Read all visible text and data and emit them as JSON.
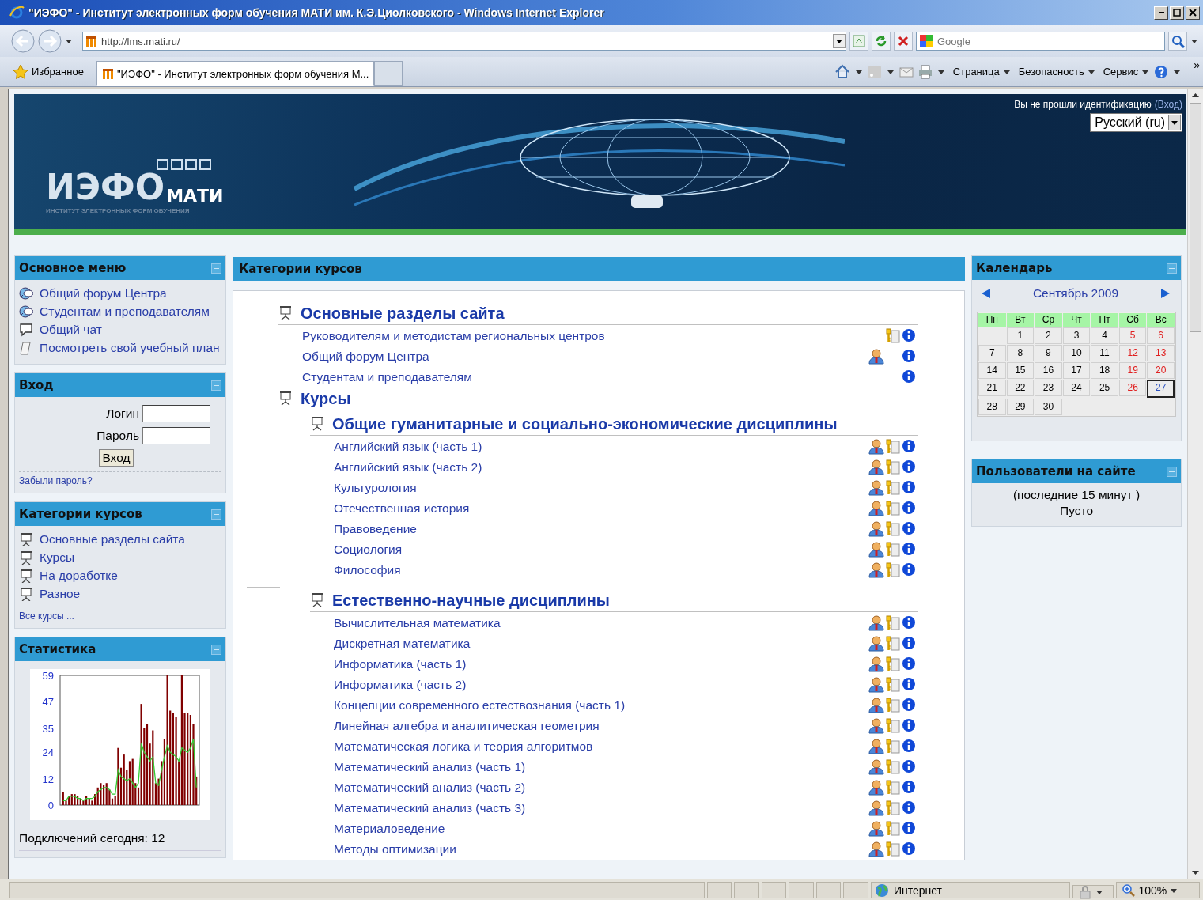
{
  "window": {
    "title": "\"ИЭФО\" - Институт электронных форм обучения МАТИ им. К.Э.Циолковского - Windows Internet Explorer"
  },
  "address_bar": {
    "value": "http://lms.mati.ru/"
  },
  "search": {
    "placeholder": "Google"
  },
  "favorites": {
    "label": "Избранное"
  },
  "tabs": [
    {
      "label": "\"ИЭФО\" - Институт электронных форм обучения М...",
      "selected": true
    }
  ],
  "command_bar": {
    "menus": [
      "Страница",
      "Безопасность",
      "Сервис"
    ],
    "overflow": "»"
  },
  "header": {
    "logo_main": "ИЭФО",
    "logo_sub": "МАТИ",
    "logo_tagline": "ИНСТИТУТ ЭЛЕКТРОННЫХ ФОРМ ОБУЧЕНИЯ",
    "login_info": "Вы не прошли идентификацию",
    "login_link": "(Вход)",
    "language": "Русский (ru)"
  },
  "main_menu": {
    "title": "Основное меню",
    "items": [
      {
        "label": "Общий форум Центра",
        "kind": "forum"
      },
      {
        "label": "Студентам и преподавателям",
        "kind": "forum"
      },
      {
        "label": "Общий чат",
        "kind": "chat"
      },
      {
        "label": "Посмотреть свой учебный план",
        "kind": "resource"
      }
    ]
  },
  "login": {
    "title": "Вход",
    "username_label": "Логин",
    "password_label": "Пароль",
    "submit": "Вход",
    "forgot_link": "Забыли пароль?"
  },
  "categories_block": {
    "title": "Категории курсов",
    "items": [
      "Основные разделы сайта",
      "Курсы",
      "На доработке",
      "Разное"
    ],
    "all_link": "Все курсы ..."
  },
  "statistics": {
    "title": "Статистика",
    "connections": "Подключений сегодня: 12",
    "chart_data": {
      "type": "bar",
      "categories": [
        null,
        null,
        null,
        null,
        null,
        null,
        null,
        null,
        null,
        null,
        null,
        null,
        null,
        null,
        null,
        null,
        null,
        null,
        null,
        null,
        null,
        null,
        null,
        null,
        null,
        null,
        null,
        null,
        null,
        null,
        null,
        null,
        null,
        null,
        null,
        null,
        null,
        null,
        null,
        null,
        null,
        null,
        null,
        null,
        null,
        null,
        null
      ],
      "ylim": [
        0,
        59
      ],
      "yticks": [
        0,
        12,
        24,
        35,
        47,
        59
      ],
      "series": [
        {
          "type": "bar",
          "color": "#800000",
          "values": [
            6,
            2,
            4,
            5,
            5,
            4,
            3,
            2,
            4,
            3,
            2,
            5,
            8,
            10,
            9,
            10,
            7,
            3,
            4,
            26,
            17,
            23,
            16,
            20,
            21,
            10,
            8,
            46,
            35,
            37,
            28,
            34,
            10,
            12,
            20,
            30,
            59,
            43,
            42,
            40,
            20,
            59,
            42,
            42,
            41,
            37,
            13
          ]
        },
        {
          "type": "line",
          "color": "#33cc33",
          "values": [
            2,
            2,
            4,
            4,
            4,
            3,
            3,
            2,
            3,
            3,
            3,
            4,
            6,
            7,
            8,
            8,
            7,
            5,
            5,
            16,
            13,
            12,
            11,
            12,
            10,
            8,
            10,
            28,
            24,
            22,
            20,
            22,
            10,
            9,
            16,
            22,
            27,
            24,
            23,
            22,
            20,
            26,
            25,
            24,
            26,
            30,
            8
          ]
        }
      ]
    }
  },
  "course_categories": {
    "title": "Категории курсов",
    "categories": [
      {
        "name": "Основные разделы сайта",
        "courses": [
          {
            "name": "Руководителям и методистам региональных центров",
            "guest_access": false,
            "enrolment_key": true,
            "summary": true
          },
          {
            "name": "Общий форум Центра",
            "guest_access": true,
            "enrolment_key": false,
            "summary": true
          },
          {
            "name": "Студентам и преподавателям",
            "guest_access": false,
            "enrolment_key": false,
            "summary": true
          }
        ]
      },
      {
        "name": "Курсы",
        "children": [
          {
            "name": "Общие гуманитарные и социально-экономические дисциплины",
            "courses": [
              {
                "name": "Английский язык (часть 1)",
                "guest_access": true,
                "enrolment_key": true,
                "summary": true
              },
              {
                "name": "Английский язык (часть 2)",
                "guest_access": true,
                "enrolment_key": true,
                "summary": true
              },
              {
                "name": "Культурология",
                "guest_access": true,
                "enrolment_key": true,
                "summary": true
              },
              {
                "name": "Отечественная история",
                "guest_access": true,
                "enrolment_key": true,
                "summary": true
              },
              {
                "name": "Правоведение",
                "guest_access": true,
                "enrolment_key": true,
                "summary": true
              },
              {
                "name": "Социология",
                "guest_access": true,
                "enrolment_key": true,
                "summary": true
              },
              {
                "name": "Философия",
                "guest_access": true,
                "enrolment_key": true,
                "summary": true
              }
            ]
          },
          {
            "name": "Естественно-научные дисциплины",
            "courses": [
              {
                "name": "Вычислительная математика",
                "guest_access": true,
                "enrolment_key": true,
                "summary": true
              },
              {
                "name": "Дискретная математика",
                "guest_access": true,
                "enrolment_key": true,
                "summary": true
              },
              {
                "name": "Информатика (часть 1)",
                "guest_access": true,
                "enrolment_key": true,
                "summary": true
              },
              {
                "name": "Информатика (часть 2)",
                "guest_access": true,
                "enrolment_key": true,
                "summary": true
              },
              {
                "name": "Концепции современного естествознания (часть 1)",
                "guest_access": true,
                "enrolment_key": true,
                "summary": true
              },
              {
                "name": "Линейная алгебра и аналитическая геометрия",
                "guest_access": true,
                "enrolment_key": true,
                "summary": true
              },
              {
                "name": "Математическая логика и теория алгоритмов",
                "guest_access": true,
                "enrolment_key": true,
                "summary": true
              },
              {
                "name": "Математический анализ (часть 1)",
                "guest_access": true,
                "enrolment_key": true,
                "summary": true
              },
              {
                "name": "Математический анализ (часть 2)",
                "guest_access": true,
                "enrolment_key": true,
                "summary": true
              },
              {
                "name": "Математический анализ (часть 3)",
                "guest_access": true,
                "enrolment_key": true,
                "summary": true
              },
              {
                "name": "Материаловедение",
                "guest_access": true,
                "enrolment_key": true,
                "summary": true
              },
              {
                "name": "Методы оптимизации",
                "guest_access": true,
                "enrolment_key": true,
                "summary": true
              }
            ]
          }
        ]
      }
    ]
  },
  "calendar": {
    "title": "Календарь",
    "month": "Сентябрь 2009",
    "weekdays": [
      "Пн",
      "Вт",
      "Ср",
      "Чт",
      "Пт",
      "Сб",
      "Вс"
    ],
    "weeks": [
      [
        {
          "day": "1",
          "weekend": false,
          "today": false
        },
        {
          "day": "2",
          "weekend": false,
          "today": false
        },
        {
          "day": "3",
          "weekend": false,
          "today": false
        },
        {
          "day": "4",
          "weekend": false,
          "today": false
        },
        {
          "day": "5",
          "weekend": true,
          "today": false
        },
        {
          "day": "6",
          "weekend": true,
          "today": false
        }
      ],
      [
        {
          "day": "7",
          "weekend": false,
          "today": false
        },
        {
          "day": "8",
          "weekend": false,
          "today": false
        },
        {
          "day": "9",
          "weekend": false,
          "today": false
        },
        {
          "day": "10",
          "weekend": false,
          "today": false
        },
        {
          "day": "11",
          "weekend": false,
          "today": false
        },
        {
          "day": "12",
          "weekend": true,
          "today": false
        },
        {
          "day": "13",
          "weekend": true,
          "today": false
        }
      ],
      [
        {
          "day": "14",
          "weekend": false,
          "today": false
        },
        {
          "day": "15",
          "weekend": false,
          "today": false
        },
        {
          "day": "16",
          "weekend": false,
          "today": false
        },
        {
          "day": "17",
          "weekend": false,
          "today": false
        },
        {
          "day": "18",
          "weekend": false,
          "today": false
        },
        {
          "day": "19",
          "weekend": true,
          "today": false
        },
        {
          "day": "20",
          "weekend": true,
          "today": false
        }
      ],
      [
        {
          "day": "21",
          "weekend": false,
          "today": false
        },
        {
          "day": "22",
          "weekend": false,
          "today": false
        },
        {
          "day": "23",
          "weekend": false,
          "today": false
        },
        {
          "day": "24",
          "weekend": false,
          "today": false
        },
        {
          "day": "25",
          "weekend": false,
          "today": false
        },
        {
          "day": "26",
          "weekend": true,
          "today": false
        },
        {
          "day": "27",
          "weekend": false,
          "today": true
        }
      ],
      [
        {
          "day": "28",
          "weekend": false,
          "today": false
        },
        {
          "day": "29",
          "weekend": false,
          "today": false
        },
        {
          "day": "30",
          "weekend": false,
          "today": false
        }
      ]
    ]
  },
  "online_users": {
    "title": "Пользователи на сайте",
    "period": "(последние 15 минут )",
    "list_text": "Пусто"
  },
  "status_bar": {
    "zone": "Интернет",
    "zoom": "100%"
  }
}
